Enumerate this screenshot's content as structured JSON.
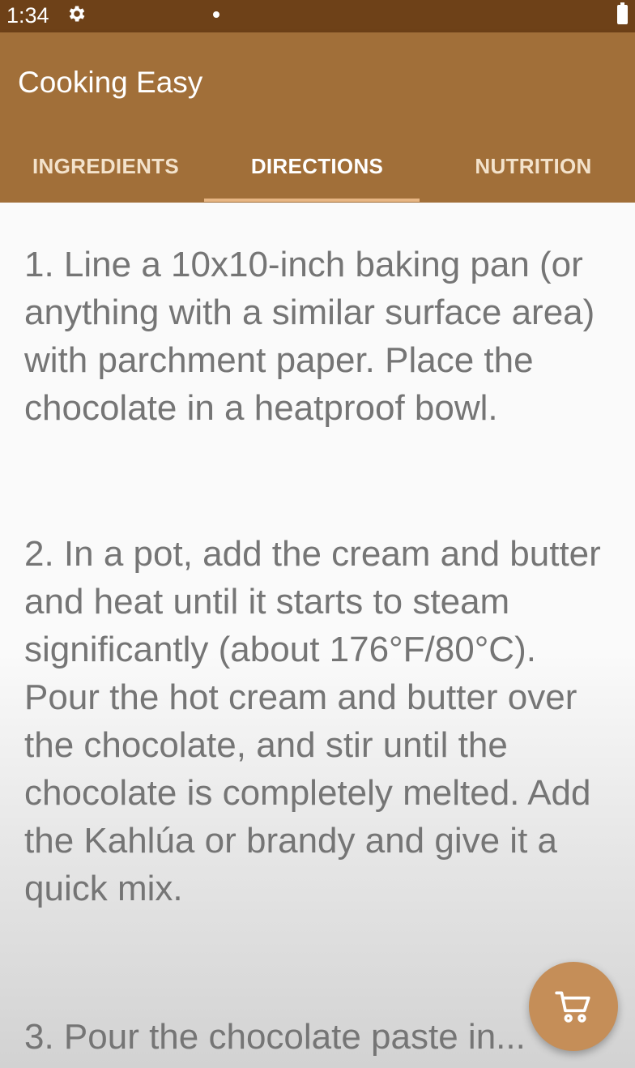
{
  "status_bar": {
    "time": "1:34",
    "icons": [
      "gear-icon",
      "notification-dot",
      "battery-icon"
    ]
  },
  "app_bar": {
    "title": "Cooking Easy",
    "tabs": [
      {
        "label": "INGREDIENTS",
        "active": false
      },
      {
        "label": "DIRECTIONS",
        "active": true
      },
      {
        "label": "NUTRITION",
        "active": false
      }
    ]
  },
  "directions": {
    "steps": [
      "1. Line a 10x10-inch baking pan (or anything with a similar surface area) with parchment paper. Place the chocolate in a heatproof bowl.",
      "2. In a pot, add the cream and butter and heat until it starts to steam significantly (about 176°F/80°C). Pour the hot cream and butter over the chocolate, and stir until the chocolate is completely melted. Add the Kahlúa or brandy and give it a quick mix.",
      "3. Pour the chocolate paste in..."
    ]
  },
  "fab": {
    "icon": "cart-icon"
  },
  "colors": {
    "status_bar": "#6e4118",
    "app_bar": "#a16f39",
    "tab_indicator": "#e7b684",
    "fab": "#c58e58",
    "body_text": "#757575"
  }
}
